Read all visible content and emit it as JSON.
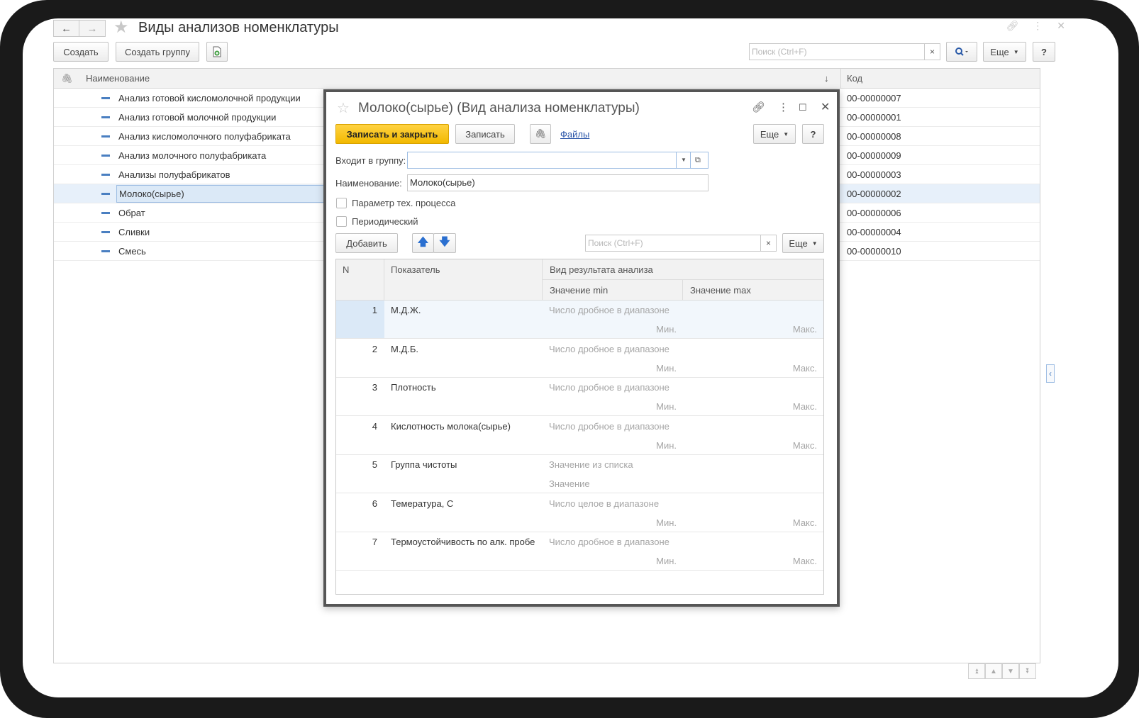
{
  "window": {
    "title": "Виды анализов номенклатуры",
    "nav_back": "←",
    "nav_forward": "→"
  },
  "toolbar": {
    "create_label": "Создать",
    "create_group_label": "Создать группу",
    "search_placeholder": "Поиск (Ctrl+F)",
    "search_clear": "×",
    "more_label": "Еще",
    "help_label": "?"
  },
  "list": {
    "columns": {
      "name": "Наименование",
      "code": "Код",
      "sort_indicator": "↓"
    },
    "rows": [
      {
        "name": "Анализ готовой кисломолочной продукции",
        "code": "00-00000007"
      },
      {
        "name": "Анализ готовой молочной продукции",
        "code": "00-00000001"
      },
      {
        "name": "Анализ кисломолочного полуфабриката",
        "code": "00-00000008"
      },
      {
        "name": "Анализ молочного полуфабриката",
        "code": "00-00000009"
      },
      {
        "name": "Анализы полуфабрикатов",
        "code": "00-00000003"
      },
      {
        "name": "Молоко(сырье)",
        "code": "00-00000002"
      },
      {
        "name": "Обрат",
        "code": "00-00000006"
      },
      {
        "name": "Сливки",
        "code": "00-00000004"
      },
      {
        "name": "Смесь",
        "code": "00-00000010"
      }
    ],
    "selected_index": 5
  },
  "dialog": {
    "title": "Молоко(сырье) (Вид анализа номенклатуры)",
    "save_close_label": "Записать и закрыть",
    "save_label": "Записать",
    "files_label": "Файлы",
    "more_label": "Еще",
    "help_label": "?",
    "group_label": "Входит в группу:",
    "group_value": "",
    "name_label": "Наименование:",
    "name_value": "Молоко(сырье)",
    "checkbox_tech": "Параметр тех. процесса",
    "checkbox_periodic": "Периодический",
    "add_label": "Добавить",
    "search_placeholder": "Поиск (Ctrl+F)",
    "search_clear": "×",
    "table_more_label": "Еще",
    "table": {
      "headers": {
        "n": "N",
        "indicator": "Показатель",
        "result_type": "Вид результата анализа",
        "min": "Значение min",
        "max": "Значение max"
      },
      "rows": [
        {
          "n": "1",
          "indicator": "М.Д.Ж.",
          "type": "Число дробное в диапазоне",
          "min": "Мин.",
          "max": "Макс."
        },
        {
          "n": "2",
          "indicator": "М.Д.Б.",
          "type": "Число дробное в диапазоне",
          "min": "Мин.",
          "max": "Макс."
        },
        {
          "n": "3",
          "indicator": "Плотность",
          "type": "Число дробное в диапазоне",
          "min": "Мин.",
          "max": "Макс."
        },
        {
          "n": "4",
          "indicator": "Кислотность молока(сырье)",
          "type": "Число дробное в диапазоне",
          "min": "Мин.",
          "max": "Макс."
        },
        {
          "n": "5",
          "indicator": "Группа чистоты",
          "type": "Значение из списка",
          "value": "Значение"
        },
        {
          "n": "6",
          "indicator": "Темература, С",
          "type": "Число целое в диапазоне",
          "min": "Мин.",
          "max": "Макс."
        },
        {
          "n": "7",
          "indicator": "Термоустойчивость по алк. пробе",
          "type": "Число дробное в диапазоне",
          "min": "Мин.",
          "max": "Макс."
        }
      ]
    }
  },
  "colors": {
    "accent_yellow": "#f2b900",
    "selection": "#e7f0fa",
    "link": "#2a55a8",
    "list_marker": "#4a7fc1"
  }
}
